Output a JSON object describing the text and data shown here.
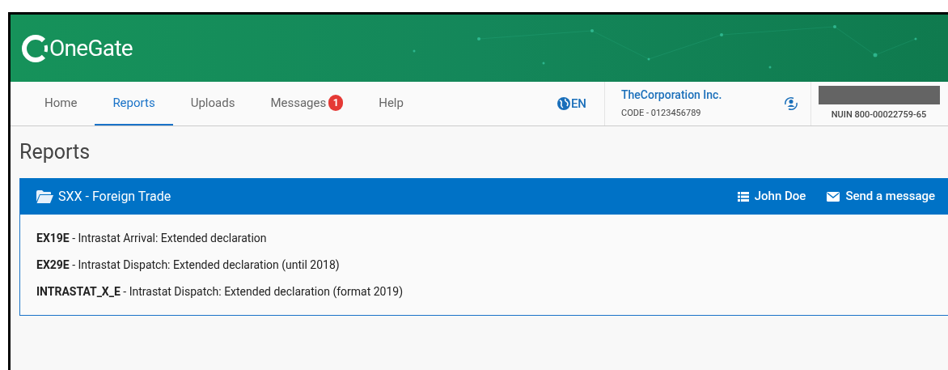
{
  "header": {
    "logo": "OneGate"
  },
  "nav": [
    {
      "label": "Home",
      "selected": false
    },
    {
      "label": "Reports",
      "selected": true
    },
    {
      "label": "Uploads",
      "selected": false
    },
    {
      "label": "Messages",
      "selected": false,
      "badge": "1"
    },
    {
      "label": "Help",
      "selected": false
    }
  ],
  "language": "EN",
  "company": {
    "name": "TheCorporation Inc.",
    "code": "CODE - 0123456789"
  },
  "user": {
    "nuin": "NUIN 800-00022759-65"
  },
  "page_title": "Reports",
  "panel": {
    "title": "SXX - Foreign Trade",
    "actions": [
      {
        "kind": "list",
        "label": "John Doe"
      },
      {
        "kind": "mail",
        "label": "Send a message"
      }
    ],
    "items": [
      "**EX19E** - Intrastat Arrival: Extended declaration",
      "**EX29E** - Intrastat Dispatch: Extended declaration (until 2018)",
      "**INTRASTAT_X_E** - Intrastat Dispatch: Extended declaration (format 2019)"
    ]
  }
}
